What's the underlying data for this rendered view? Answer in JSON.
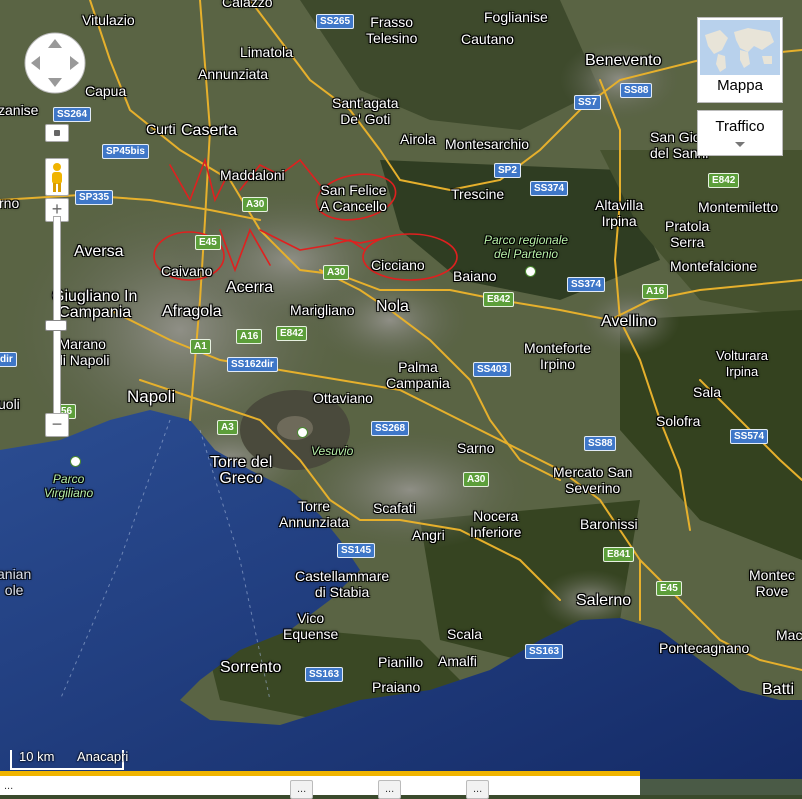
{
  "map": {
    "type": "satellite",
    "region": "Campania"
  },
  "places": [
    {
      "id": "vitulazio",
      "text": "Vitulazio"
    },
    {
      "id": "calazzo",
      "text": "Calazzo"
    },
    {
      "id": "frasso",
      "text": "Frasso\nTelesino"
    },
    {
      "id": "foglianise",
      "text": "Foglianise"
    },
    {
      "id": "cautano",
      "text": "Cautano"
    },
    {
      "id": "benevento",
      "text": "Benevento"
    },
    {
      "id": "limatola",
      "text": "Limatola"
    },
    {
      "id": "annunziata",
      "text": "Annunziata"
    },
    {
      "id": "capua",
      "text": "Capua"
    },
    {
      "id": "santagata",
      "text": "Sant'agata\nDe' Goti"
    },
    {
      "id": "curti",
      "text": "Curti"
    },
    {
      "id": "caserta",
      "text": "Caserta"
    },
    {
      "id": "airola",
      "text": "Airola"
    },
    {
      "id": "montesarchio",
      "text": "Montesarchio"
    },
    {
      "id": "sangio",
      "text": "San Gio\ndel Sanni"
    },
    {
      "id": "zanise",
      "text": "zanise"
    },
    {
      "id": "maddaloni",
      "text": "Maddaloni"
    },
    {
      "id": "sanfelice",
      "text": "San Felice\nA Cancello"
    },
    {
      "id": "trescine",
      "text": "Trescine"
    },
    {
      "id": "altavilla",
      "text": "Altavilla\nIrpina"
    },
    {
      "id": "pratola",
      "text": "Pratola\nSerra"
    },
    {
      "id": "montemiletto",
      "text": "Montemiletto"
    },
    {
      "id": "rno",
      "text": "rno"
    },
    {
      "id": "aversa",
      "text": "Aversa"
    },
    {
      "id": "caivano",
      "text": "Caivano"
    },
    {
      "id": "cicciano",
      "text": "Cicciano"
    },
    {
      "id": "baiano",
      "text": "Baiano"
    },
    {
      "id": "montefalcione",
      "text": "Montefalcione"
    },
    {
      "id": "giugliano",
      "text": "Giugliano In\nCampania"
    },
    {
      "id": "acerra",
      "text": "Acerra"
    },
    {
      "id": "afragola",
      "text": "Afragola"
    },
    {
      "id": "marigliano",
      "text": "Marigliano"
    },
    {
      "id": "nola",
      "text": "Nola"
    },
    {
      "id": "avellino",
      "text": "Avellino"
    },
    {
      "id": "marano",
      "text": "Marano\ndi Napoli"
    },
    {
      "id": "monteforte",
      "text": "Monteforte\nIrpino"
    },
    {
      "id": "volturara",
      "text": "Volturara\nIrpina"
    },
    {
      "id": "palma",
      "text": "Palma\nCampania"
    },
    {
      "id": "ottaviano",
      "text": "Ottaviano"
    },
    {
      "id": "napoli",
      "text": "Napoli"
    },
    {
      "id": "uoli",
      "text": "uoli"
    },
    {
      "id": "sala",
      "text": "Sala"
    },
    {
      "id": "solofra",
      "text": "Solofra"
    },
    {
      "id": "sarno",
      "text": "Sarno"
    },
    {
      "id": "torredelgreco",
      "text": "Torre del\nGreco"
    },
    {
      "id": "mercato",
      "text": "Mercato San\nSeverino"
    },
    {
      "id": "torreann",
      "text": "Torre\nAnnunziata"
    },
    {
      "id": "scafati",
      "text": "Scafati"
    },
    {
      "id": "nocera",
      "text": "Nocera\nInferiore"
    },
    {
      "id": "angri",
      "text": "Angri"
    },
    {
      "id": "baronissi",
      "text": "Baronissi"
    },
    {
      "id": "castellammare",
      "text": "Castellammare\ndi Stabia"
    },
    {
      "id": "salerno",
      "text": "Salerno"
    },
    {
      "id": "montec",
      "text": "Montec\nRove"
    },
    {
      "id": "vico",
      "text": "Vico\nEquense"
    },
    {
      "id": "scala",
      "text": "Scala"
    },
    {
      "id": "sorrento",
      "text": "Sorrento"
    },
    {
      "id": "piano",
      "text": "Pianillo"
    },
    {
      "id": "amalfi",
      "text": "Amalfi"
    },
    {
      "id": "praiano",
      "text": "Praiano"
    },
    {
      "id": "pontecagnano",
      "text": "Pontecagnano"
    },
    {
      "id": "mac",
      "text": "Mac"
    },
    {
      "id": "batti",
      "text": "Batti"
    },
    {
      "id": "anian",
      "text": "anian\nole"
    }
  ],
  "parks": [
    {
      "id": "partenio",
      "text": "Parco regionale\ndel Partenio"
    },
    {
      "id": "vesuvio",
      "text": "Vesuvio"
    },
    {
      "id": "virgiliano",
      "text": "Parco\nVirgiliano"
    }
  ],
  "road_shields": [
    {
      "id": "ss265",
      "text": "SS265",
      "color": "blue"
    },
    {
      "id": "ss264",
      "text": "SS264",
      "color": "blue"
    },
    {
      "id": "sp45bis",
      "text": "SP45bis",
      "color": "blue"
    },
    {
      "id": "sp335",
      "text": "SP335",
      "color": "blue"
    },
    {
      "id": "a30a",
      "text": "A30",
      "color": "green"
    },
    {
      "id": "sp2",
      "text": "SP2",
      "color": "blue"
    },
    {
      "id": "ss374a",
      "text": "SS374",
      "color": "blue"
    },
    {
      "id": "ss7",
      "text": "SS7",
      "color": "blue"
    },
    {
      "id": "ss88a",
      "text": "SS88",
      "color": "blue"
    },
    {
      "id": "e842a",
      "text": "E842",
      "color": "green"
    },
    {
      "id": "e45a",
      "text": "E45",
      "color": "green"
    },
    {
      "id": "a30b",
      "text": "A30",
      "color": "green"
    },
    {
      "id": "e842b",
      "text": "E842",
      "color": "green"
    },
    {
      "id": "ss374b",
      "text": "SS374",
      "color": "blue"
    },
    {
      "id": "a16a",
      "text": "A16",
      "color": "green"
    },
    {
      "id": "a16b",
      "text": "A16",
      "color": "green"
    },
    {
      "id": "e842c",
      "text": "E842",
      "color": "green"
    },
    {
      "id": "a1",
      "text": "A1",
      "color": "green"
    },
    {
      "id": "ss162dir",
      "text": "SS162dir",
      "color": "blue"
    },
    {
      "id": "ss403",
      "text": "SS403",
      "color": "blue"
    },
    {
      "id": "a56",
      "text": "56",
      "color": "green"
    },
    {
      "id": "dir",
      "text": "dir",
      "color": "blue"
    },
    {
      "id": "a3",
      "text": "A3",
      "color": "green"
    },
    {
      "id": "ss268",
      "text": "SS268",
      "color": "blue"
    },
    {
      "id": "ss88b",
      "text": "SS88",
      "color": "blue"
    },
    {
      "id": "ss574",
      "text": "SS574",
      "color": "blue"
    },
    {
      "id": "a30c",
      "text": "A30",
      "color": "green"
    },
    {
      "id": "ss145",
      "text": "SS145",
      "color": "blue"
    },
    {
      "id": "e841",
      "text": "E841",
      "color": "green"
    },
    {
      "id": "e45b",
      "text": "E45",
      "color": "green"
    },
    {
      "id": "ss163a",
      "text": "SS163",
      "color": "blue"
    },
    {
      "id": "ss163b",
      "text": "SS163",
      "color": "blue"
    }
  ],
  "controls": {
    "map_button": "Mappa",
    "traffic_button": "Traffico",
    "zoom_in": "+",
    "zoom_out": "−"
  },
  "scale": {
    "distance": "10 km",
    "attribution": "Anacapri"
  },
  "bottom_bar": {
    "text": "...",
    "buttons": [
      "...",
      "...",
      "..."
    ]
  },
  "colors": {
    "annotation": "#e0201f",
    "sea": "#1f3a7a",
    "land": "#4b5a36"
  }
}
